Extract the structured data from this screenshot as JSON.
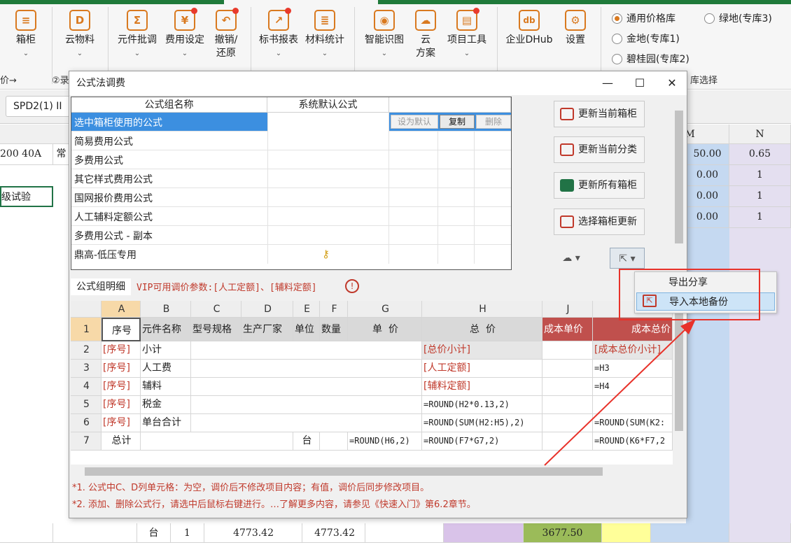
{
  "ribbon": {
    "buttons": [
      {
        "label": "箱柜",
        "glyph": "≡"
      },
      {
        "label": "云物料",
        "glyph": "D"
      },
      {
        "label": "元件批调",
        "glyph": "Σ"
      },
      {
        "label": "费用设定",
        "glyph": "¥"
      },
      {
        "label": "撤销/\n还原",
        "glyph": "↶"
      },
      {
        "label": "标书报表",
        "glyph": "↗"
      },
      {
        "label": "材料统计",
        "glyph": "≣"
      },
      {
        "label": "智能识图",
        "glyph": "◉"
      },
      {
        "label": "云\n方案",
        "glyph": "☁"
      },
      {
        "label": "项目工具",
        "glyph": "▤"
      },
      {
        "label": "企业DHub",
        "glyph": "db"
      },
      {
        "label": "设置",
        "glyph": "⚙"
      }
    ],
    "group_left": "价→",
    "group_left2": "②录",
    "group_right": "库选择",
    "radios": [
      {
        "label": "通用价格库",
        "checked": true
      },
      {
        "label": "绿地(专库3)",
        "checked": false
      },
      {
        "label": "金地(专库1)",
        "checked": false
      },
      {
        "label": "碧桂园(专库2)",
        "checked": false
      }
    ]
  },
  "sheet_tab": "SPD2(1) II",
  "background": {
    "col_m": "M",
    "col_n": "N",
    "row1_left": "200  40A",
    "row1_left2": "常",
    "row1_m": "50.00",
    "row1_n": "0.65",
    "row2_left": "级试验",
    "row2_m": "0.00",
    "row2_n": "1",
    "row3_m": "0.00",
    "row3_n": "1",
    "row4_m": "0.00",
    "row4_n": "1",
    "bottom_unit": "台",
    "bottom_qty": "1",
    "bottom_price1": "4773.42",
    "bottom_price2": "4773.42",
    "bottom_cost": "3677.50"
  },
  "dialog": {
    "title": "公式法调费",
    "minimize": "—",
    "maximize": "☐",
    "close": "✕",
    "table_headers": {
      "name": "公式组名称",
      "default": "系统默认公式"
    },
    "mini_buttons": {
      "set_default": "设为默认",
      "copy": "复制",
      "delete": "删除"
    },
    "formulas": [
      "选中箱柜使用的公式",
      "简易费用公式",
      "多费用公式",
      "其它样式费用公式",
      "国网报价费用公式",
      "人工辅料定额公式",
      "多费用公式 - 副本",
      "鼎高-低压专用"
    ],
    "side_buttons": [
      "更新当前箱柜",
      "更新当前分类",
      "更新所有箱柜",
      "选择箱柜更新"
    ],
    "detail_label": "公式组明细",
    "vip_text": "VIP可用调价参数:[人工定额]、[辅料定额]",
    "grid": {
      "col_letters": [
        "A",
        "B",
        "C",
        "D",
        "E",
        "F",
        "G",
        "H",
        "J",
        ""
      ],
      "header": [
        "序号",
        "元件名称",
        "型号规格",
        "生产厂家",
        "单位",
        "数量",
        "单  价",
        "总  价",
        "成本单价",
        "成本总价"
      ],
      "rows": [
        {
          "n": "2",
          "a": "[序号]",
          "b": "小计",
          "h": "[总价小计]",
          "k": "[成本总价小计]"
        },
        {
          "n": "3",
          "a": "[序号]",
          "b": "人工费",
          "h": "[人工定额]",
          "k": "=H3"
        },
        {
          "n": "4",
          "a": "[序号]",
          "b": "辅料",
          "h": "[辅料定额]",
          "k": "=H4"
        },
        {
          "n": "5",
          "a": "[序号]",
          "b": "税金",
          "h": "=ROUND(H2*0.13,2)",
          "k": ""
        },
        {
          "n": "6",
          "a": "[序号]",
          "b": "单台合计",
          "h": "=ROUND(SUM(H2:H5),2)",
          "k": "=ROUND(SUM(K2:"
        },
        {
          "n": "7",
          "a": "总计",
          "b": "",
          "e": "台",
          "g": "=ROUND(H6,2)",
          "h": "=ROUND(F7*G7,2)",
          "k": "=ROUND(K6*F7,2"
        }
      ]
    },
    "notes": [
      "*1. 公式中C、D列单元格：为空，调价后不修改项目内容；有值，调价后同步修改项目。",
      "*2. 添加、删除公式行，请选中后鼠标右键进行。…了解更多内容，请参见《快速入门》第6.2章节。"
    ]
  },
  "context_menu": [
    "导出分享",
    "导入本地备份"
  ],
  "colors": {
    "selected": "#3c8fe0",
    "accent": "#d9791f",
    "alert": "#e8322a",
    "cost_header": "#c0504d"
  }
}
